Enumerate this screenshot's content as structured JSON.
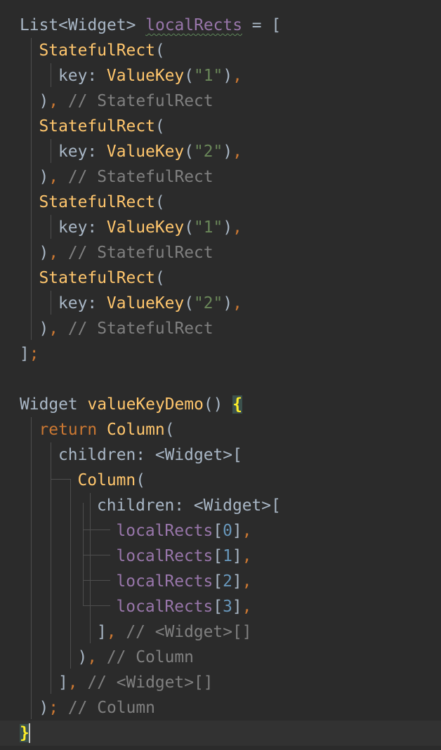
{
  "editor": {
    "colors": {
      "background": "#2b2b2b",
      "current_line": "#323232",
      "class_name": "#ffc66d",
      "keyword": "#cc7832",
      "field": "#9876aa",
      "number": "#6897bb",
      "string": "#6a8759",
      "comment": "#808080",
      "plain": "#a9b7c6",
      "matched_brace": "#ffef28"
    },
    "lines": [
      {
        "tokens": [
          [
            "tok-plain",
            "List<Widget> "
          ],
          [
            "tok-field squiggle-hint",
            "localRects"
          ],
          [
            "tok-plain",
            " = ["
          ]
        ]
      },
      {
        "tokens": [
          [
            "tok-class",
            "StatefulRect"
          ],
          [
            "tok-plain",
            "("
          ]
        ]
      },
      {
        "tokens": [
          [
            "tok-plain",
            "key: "
          ],
          [
            "tok-class",
            "ValueKey"
          ],
          [
            "tok-plain",
            "("
          ],
          [
            "tok-str",
            "\"1\""
          ],
          [
            "tok-plain",
            ")"
          ],
          [
            "tok-punct",
            ","
          ]
        ]
      },
      {
        "tokens": [
          [
            "tok-plain",
            ")"
          ],
          [
            "tok-punct",
            ","
          ],
          [
            "tok-comment",
            " // StatefulRect"
          ]
        ]
      },
      {
        "tokens": [
          [
            "tok-class",
            "StatefulRect"
          ],
          [
            "tok-plain",
            "("
          ]
        ]
      },
      {
        "tokens": [
          [
            "tok-plain",
            "key: "
          ],
          [
            "tok-class",
            "ValueKey"
          ],
          [
            "tok-plain",
            "("
          ],
          [
            "tok-str",
            "\"2\""
          ],
          [
            "tok-plain",
            ")"
          ],
          [
            "tok-punct",
            ","
          ]
        ]
      },
      {
        "tokens": [
          [
            "tok-plain",
            ")"
          ],
          [
            "tok-punct",
            ","
          ],
          [
            "tok-comment",
            " // StatefulRect"
          ]
        ]
      },
      {
        "tokens": [
          [
            "tok-class",
            "StatefulRect"
          ],
          [
            "tok-plain",
            "("
          ]
        ]
      },
      {
        "tokens": [
          [
            "tok-plain",
            "key: "
          ],
          [
            "tok-class",
            "ValueKey"
          ],
          [
            "tok-plain",
            "("
          ],
          [
            "tok-str",
            "\"1\""
          ],
          [
            "tok-plain",
            ")"
          ],
          [
            "tok-punct",
            ","
          ]
        ]
      },
      {
        "tokens": [
          [
            "tok-plain",
            ")"
          ],
          [
            "tok-punct",
            ","
          ],
          [
            "tok-comment",
            " // StatefulRect"
          ]
        ]
      },
      {
        "tokens": [
          [
            "tok-class",
            "StatefulRect"
          ],
          [
            "tok-plain",
            "("
          ]
        ]
      },
      {
        "tokens": [
          [
            "tok-plain",
            "key: "
          ],
          [
            "tok-class",
            "ValueKey"
          ],
          [
            "tok-plain",
            "("
          ],
          [
            "tok-str",
            "\"2\""
          ],
          [
            "tok-plain",
            ")"
          ],
          [
            "tok-punct",
            ","
          ]
        ]
      },
      {
        "tokens": [
          [
            "tok-plain",
            ")"
          ],
          [
            "tok-punct",
            ","
          ],
          [
            "tok-comment",
            " // StatefulRect"
          ]
        ]
      },
      {
        "tokens": [
          [
            "tok-plain",
            "]"
          ],
          [
            "tok-punct",
            ";"
          ]
        ]
      },
      {
        "tokens": []
      },
      {
        "tokens": [
          [
            "tok-plain",
            "Widget "
          ],
          [
            "tok-class",
            "valueKeyDemo"
          ],
          [
            "tok-plain",
            "() "
          ],
          [
            "brace-match",
            "{"
          ]
        ]
      },
      {
        "tokens": [
          [
            "tok-kw",
            "return "
          ],
          [
            "tok-class",
            "Column"
          ],
          [
            "tok-plain",
            "("
          ]
        ]
      },
      {
        "tokens": [
          [
            "tok-plain",
            "children: <Widget>["
          ]
        ]
      },
      {
        "tokens": [
          [
            "tok-class",
            "Column"
          ],
          [
            "tok-plain",
            "("
          ]
        ]
      },
      {
        "tokens": [
          [
            "tok-plain",
            "children: <Widget>["
          ]
        ]
      },
      {
        "tokens": [
          [
            "tok-field",
            "localRects"
          ],
          [
            "tok-plain",
            "["
          ],
          [
            "tok-num",
            "0"
          ],
          [
            "tok-plain",
            "]"
          ],
          [
            "tok-punct",
            ","
          ]
        ]
      },
      {
        "tokens": [
          [
            "tok-field",
            "localRects"
          ],
          [
            "tok-plain",
            "["
          ],
          [
            "tok-num",
            "1"
          ],
          [
            "tok-plain",
            "]"
          ],
          [
            "tok-punct",
            ","
          ]
        ]
      },
      {
        "tokens": [
          [
            "tok-field",
            "localRects"
          ],
          [
            "tok-plain",
            "["
          ],
          [
            "tok-num",
            "2"
          ],
          [
            "tok-plain",
            "]"
          ],
          [
            "tok-punct",
            ","
          ]
        ]
      },
      {
        "tokens": [
          [
            "tok-field",
            "localRects"
          ],
          [
            "tok-plain",
            "["
          ],
          [
            "tok-num",
            "3"
          ],
          [
            "tok-plain",
            "]"
          ],
          [
            "tok-punct",
            ","
          ]
        ]
      },
      {
        "tokens": [
          [
            "tok-plain",
            "]"
          ],
          [
            "tok-punct",
            ","
          ],
          [
            "tok-comment",
            " // <Widget>[]"
          ]
        ]
      },
      {
        "tokens": [
          [
            "tok-plain",
            ")"
          ],
          [
            "tok-punct",
            ","
          ],
          [
            "tok-comment",
            " // Column"
          ]
        ]
      },
      {
        "tokens": [
          [
            "tok-plain",
            "]"
          ],
          [
            "tok-punct",
            ","
          ],
          [
            "tok-comment",
            " // <Widget>[]"
          ]
        ]
      },
      {
        "tokens": [
          [
            "tok-plain",
            ")"
          ],
          [
            "tok-punct",
            ";"
          ],
          [
            "tok-comment",
            " // Column"
          ]
        ]
      },
      {
        "tokens": [
          [
            "brace-match",
            "}"
          ]
        ]
      }
    ]
  }
}
